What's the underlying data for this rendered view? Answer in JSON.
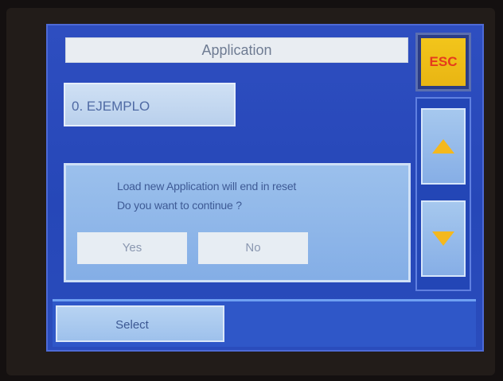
{
  "screen": {
    "title": "Application",
    "esc_label": "ESC",
    "selected_app": "0. EJEMPLO",
    "up_arrow_icon": "triangle-up-icon",
    "down_arrow_icon": "triangle-down-icon",
    "accent_color": "#f4b81e",
    "esc_text_color": "#e53b1d"
  },
  "dialog": {
    "line1": "Load new Application will end in reset",
    "line2": "Do you want to continue ?",
    "yes_label": "Yes",
    "no_label": "No"
  },
  "footer": {
    "select_label": "Select"
  }
}
